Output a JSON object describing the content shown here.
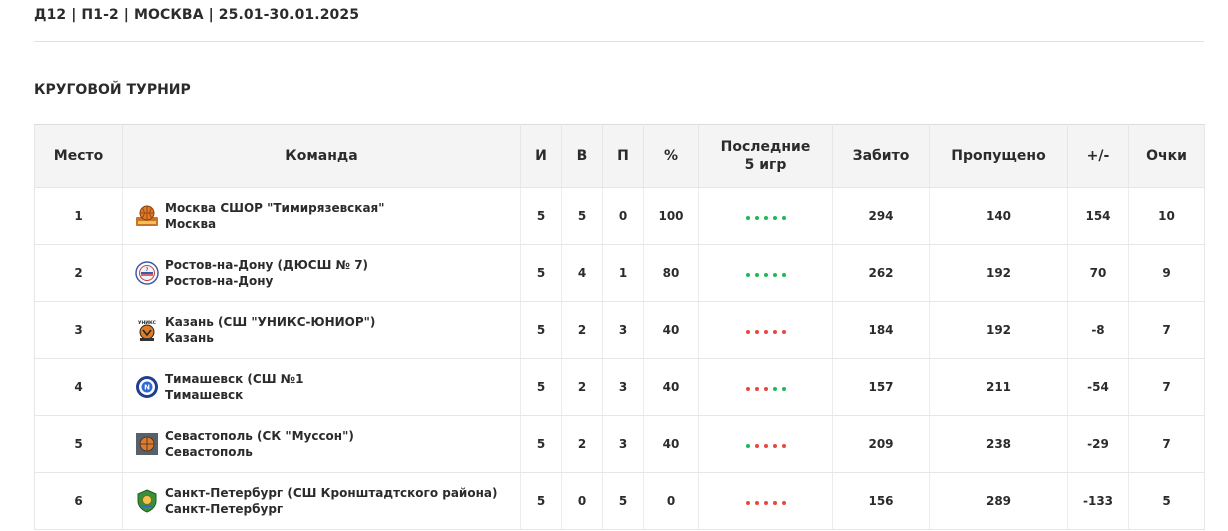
{
  "header": {
    "title": "Д12 | П1-2 | МОСКВА | 25.01-30.01.2025"
  },
  "section": {
    "title": "КРУГОВОЙ ТУРНИР"
  },
  "table": {
    "columns": {
      "place": "Место",
      "team": "Команда",
      "games": "И",
      "wins": "В",
      "losses": "П",
      "percent": "%",
      "last5_line1": "Последние",
      "last5_line2": "5 игр",
      "scored": "Забито",
      "conceded": "Пропущено",
      "diff": "+/-",
      "points": "Очки"
    },
    "colors": {
      "win": "#1db954",
      "loss": "#e8473c"
    },
    "rows": [
      {
        "place": "1",
        "team": "Москва СШОР \"Тимирязевская\"",
        "city": "Москва",
        "logo_icon": "basketball-team-logo-icon",
        "games": "5",
        "wins": "5",
        "losses": "0",
        "percent": "100",
        "last5": [
          "W",
          "W",
          "W",
          "W",
          "W"
        ],
        "scored": "294",
        "conceded": "140",
        "diff": "154",
        "points": "10"
      },
      {
        "place": "2",
        "team": "Ростов-на-Дону (ДЮСШ № 7)",
        "city": "Ростов-на-Дону",
        "logo_icon": "round-team-logo-icon",
        "games": "5",
        "wins": "4",
        "losses": "1",
        "percent": "80",
        "last5": [
          "W",
          "W",
          "W",
          "W",
          "W"
        ],
        "scored": "262",
        "conceded": "192",
        "diff": "70",
        "points": "9"
      },
      {
        "place": "3",
        "team": "Казань (СШ \"УНИКС-ЮНИОР\")",
        "city": "Казань",
        "logo_icon": "unics-logo-icon",
        "games": "5",
        "wins": "2",
        "losses": "3",
        "percent": "40",
        "last5": [
          "L",
          "L",
          "L",
          "L",
          "L"
        ],
        "scored": "184",
        "conceded": "192",
        "diff": "-8",
        "points": "7"
      },
      {
        "place": "4",
        "team": "Тимашевск (СШ №1",
        "city": "Тимашевск",
        "logo_icon": "badge-team-logo-icon",
        "games": "5",
        "wins": "2",
        "losses": "3",
        "percent": "40",
        "last5": [
          "L",
          "L",
          "L",
          "W",
          "W"
        ],
        "scored": "157",
        "conceded": "211",
        "diff": "-54",
        "points": "7"
      },
      {
        "place": "5",
        "team": "Севастополь (СК \"Муссон\")",
        "city": "Севастополь",
        "logo_icon": "square-team-logo-icon",
        "games": "5",
        "wins": "2",
        "losses": "3",
        "percent": "40",
        "last5": [
          "W",
          "L",
          "L",
          "L",
          "L"
        ],
        "scored": "209",
        "conceded": "238",
        "diff": "-29",
        "points": "7"
      },
      {
        "place": "6",
        "team": "Санкт-Петербург (СШ Кронштадтского района)",
        "city": "Санкт-Петербург",
        "logo_icon": "shield-team-logo-icon",
        "games": "5",
        "wins": "0",
        "losses": "5",
        "percent": "0",
        "last5": [
          "L",
          "L",
          "L",
          "L",
          "L"
        ],
        "scored": "156",
        "conceded": "289",
        "diff": "-133",
        "points": "5"
      }
    ]
  }
}
